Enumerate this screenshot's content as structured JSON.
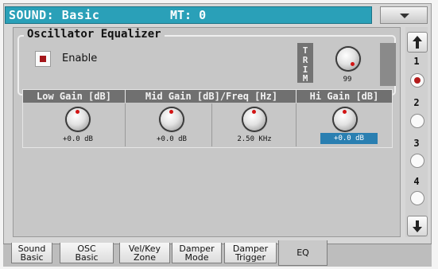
{
  "header": {
    "title": "SOUND: Basic",
    "mt": "MT: 0"
  },
  "menu_button": {
    "icon": "chevron-down-icon"
  },
  "group": {
    "title": "Oscillator Equalizer",
    "enable": {
      "label": "Enable",
      "checked": true
    },
    "trim": {
      "label_chars": [
        "T",
        "R",
        "I",
        "M"
      ],
      "value": "99"
    }
  },
  "eq": {
    "columns": [
      {
        "title": "Low Gain [dB]",
        "value": "+0.0 dB",
        "selected": false
      },
      {
        "title": "Mid Gain [dB]/Freq [Hz]",
        "value": "+0.0 dB",
        "selected": false
      },
      {
        "title": "",
        "value": "2.50 KHz",
        "selected": false
      },
      {
        "title": "Hi Gain [dB]",
        "value": "+0.0 dB",
        "selected": true
      }
    ]
  },
  "scrollbar": {
    "pages": [
      "1",
      "2",
      "3",
      "4"
    ],
    "selected_page": "1",
    "up_icon": "arrow-up-icon",
    "down_icon": "arrow-down-icon"
  },
  "tabs": [
    {
      "line1": "Sound",
      "line2": "Basic"
    },
    {
      "line1": "OSC",
      "line2": "Basic"
    },
    {
      "line1": "Vel/Key",
      "line2": "Zone"
    },
    {
      "line1": "Damper",
      "line2": "Mode"
    },
    {
      "line1": "Damper",
      "line2": "Trigger"
    },
    {
      "line1": "EQ",
      "line2": ""
    }
  ],
  "active_tab": "EQ",
  "colors": {
    "header": "#2aa0b8",
    "selected_value": "#2a7fb1",
    "indicator": "#a4161a"
  }
}
